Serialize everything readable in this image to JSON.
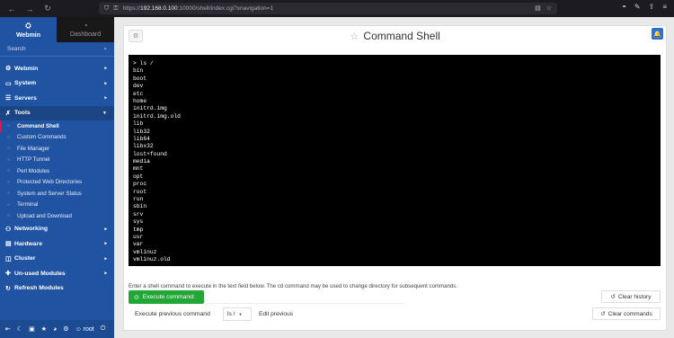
{
  "browser": {
    "url_prefix": "https://",
    "url_host": "192.168.0.100",
    "url_rest": ":10000/shell/index.cgi?xnavigation=1"
  },
  "sidebar": {
    "tab_webmin": "Webmin",
    "tab_dashboard": "Dashboard",
    "search_label": "Search",
    "categories_top": [
      {
        "icon": "gear-icon",
        "glyph": "⚙",
        "label": "Webmin"
      },
      {
        "icon": "monitor-icon",
        "glyph": "▭",
        "label": "System"
      },
      {
        "icon": "server-icon",
        "glyph": "☰",
        "label": "Servers"
      }
    ],
    "tools_label": "Tools",
    "tools_items": [
      {
        "label": "Command Shell",
        "active": true
      },
      {
        "label": "Custom Commands"
      },
      {
        "label": "File Manager"
      },
      {
        "label": "HTTP Tunnel"
      },
      {
        "label": "Perl Modules"
      },
      {
        "label": "Protected Web Directories"
      },
      {
        "label": "System and Server Status"
      },
      {
        "label": "Terminal"
      },
      {
        "label": "Upload and Download"
      }
    ],
    "categories_bottom": [
      {
        "icon": "network-icon",
        "glyph": "⚇",
        "label": "Networking"
      },
      {
        "icon": "hardware-icon",
        "glyph": "▤",
        "label": "Hardware"
      },
      {
        "icon": "cluster-icon",
        "glyph": "◫",
        "label": "Cluster"
      },
      {
        "icon": "puzzle-icon",
        "glyph": "✚",
        "label": "Un-used Modules"
      },
      {
        "icon": "refresh-icon",
        "glyph": "↻",
        "label": "Refresh Modules"
      }
    ],
    "user_name": "root"
  },
  "page": {
    "title": "Command Shell",
    "terminal_lines": [
      "> ls /",
      "bin",
      "boot",
      "dev",
      "etc",
      "home",
      "initrd.img",
      "initrd.img.old",
      "lib",
      "lib32",
      "lib64",
      "libx32",
      "lost+found",
      "media",
      "mnt",
      "opt",
      "proc",
      "root",
      "run",
      "sbin",
      "srv",
      "sys",
      "tmp",
      "usr",
      "var",
      "vmlinuz",
      "vmlinuz.old"
    ],
    "hint": "Enter a shell command to execute in the text field below. The cd command may be used to change directory for subsequent commands.",
    "execute_label": "Execute command:",
    "command_value": "",
    "clear_history_label": "Clear history",
    "prev_label": "Execute previous command",
    "prev_selected": "ls /",
    "edit_prev_label": "Edit previous",
    "clear_commands_label": "Clear commands"
  }
}
